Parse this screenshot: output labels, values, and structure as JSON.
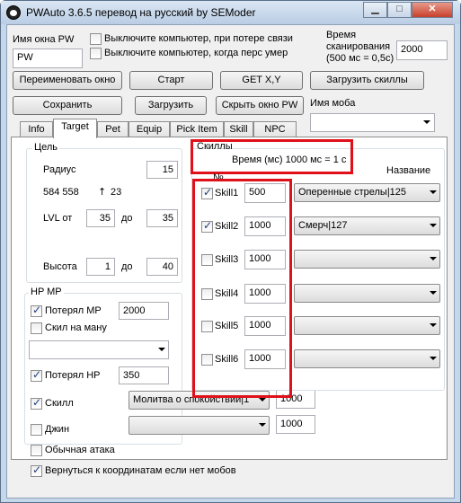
{
  "window": {
    "title": "PWAuto 3.6.5 перевод на русский by SEModer",
    "min": "▁",
    "max": "□",
    "close": "✕"
  },
  "top": {
    "window_name_label": "Имя окна PW",
    "window_name_value": "PW",
    "shutdown_disconnect": "Выключите компьютер, при потере связи",
    "shutdown_death": "Выключите компьютер, когда перс умер",
    "scan_time_label_1": "Время",
    "scan_time_label_2": "сканирования",
    "scan_time_label_3": "(500 мс = 0,5с)",
    "scan_time_value": "2000"
  },
  "buttons": {
    "rename": "Переименовать окно",
    "start": "Старт",
    "getxy": "GET X,Y",
    "load_skills": "Загрузить скиллы",
    "save": "Сохранить",
    "load": "Загрузить",
    "hide": "Скрыть окно PW"
  },
  "mob": {
    "label": "Имя моба",
    "value": ""
  },
  "tabs": [
    "Info",
    "Target",
    "Pet",
    "Equip",
    "Pick Item",
    "Skill",
    "NPC"
  ],
  "target": {
    "group_title": "Цель",
    "radius_label": "Радиус",
    "radius_value": "15",
    "coords": "584 558",
    "arrow": "↑",
    "coord_z": "23",
    "lvl_from_label": "LVL от",
    "lvl_from": "35",
    "lvl_to_label": "до",
    "lvl_to": "35",
    "height_label": "Высота",
    "height_from": "1",
    "height_to_label": "до",
    "height_to": "40"
  },
  "hpmp": {
    "group_title": "HP MP",
    "lost_mp_label": "Потерял MP",
    "lost_mp_value": "2000",
    "skill_mana_label": "Скил на ману",
    "skill_mana_combo": "",
    "lost_hp_label": "Потерял HP",
    "lost_hp_value": "350",
    "skill_label": "Скилл",
    "skill_combo": "Молитва о спокойствии|1",
    "skill_value": "1000",
    "djin_label": "Джин",
    "djin_combo": "",
    "djin_value": "1000"
  },
  "normal_attack": "Обычная атака",
  "return_coords": "Вернуться к координатам если нет мобов",
  "skills": {
    "group_title": "Скиллы",
    "time_label": "Время (мс) 1000 мс = 1 с",
    "col_no": "№",
    "col_name": "Название",
    "rows": [
      {
        "label": "Skill1",
        "checked": true,
        "value": "500",
        "name": "Оперенные стрелы|125"
      },
      {
        "label": "Skill2",
        "checked": true,
        "value": "1000",
        "name": "Смерч|127"
      },
      {
        "label": "Skill3",
        "checked": false,
        "value": "1000",
        "name": ""
      },
      {
        "label": "Skill4",
        "checked": false,
        "value": "1000",
        "name": ""
      },
      {
        "label": "Skill5",
        "checked": false,
        "value": "1000",
        "name": ""
      },
      {
        "label": "Skill6",
        "checked": false,
        "value": "1000",
        "name": ""
      }
    ]
  },
  "colors": {
    "highlight": "#e0101a",
    "titlebar": "#c5d7ea"
  }
}
